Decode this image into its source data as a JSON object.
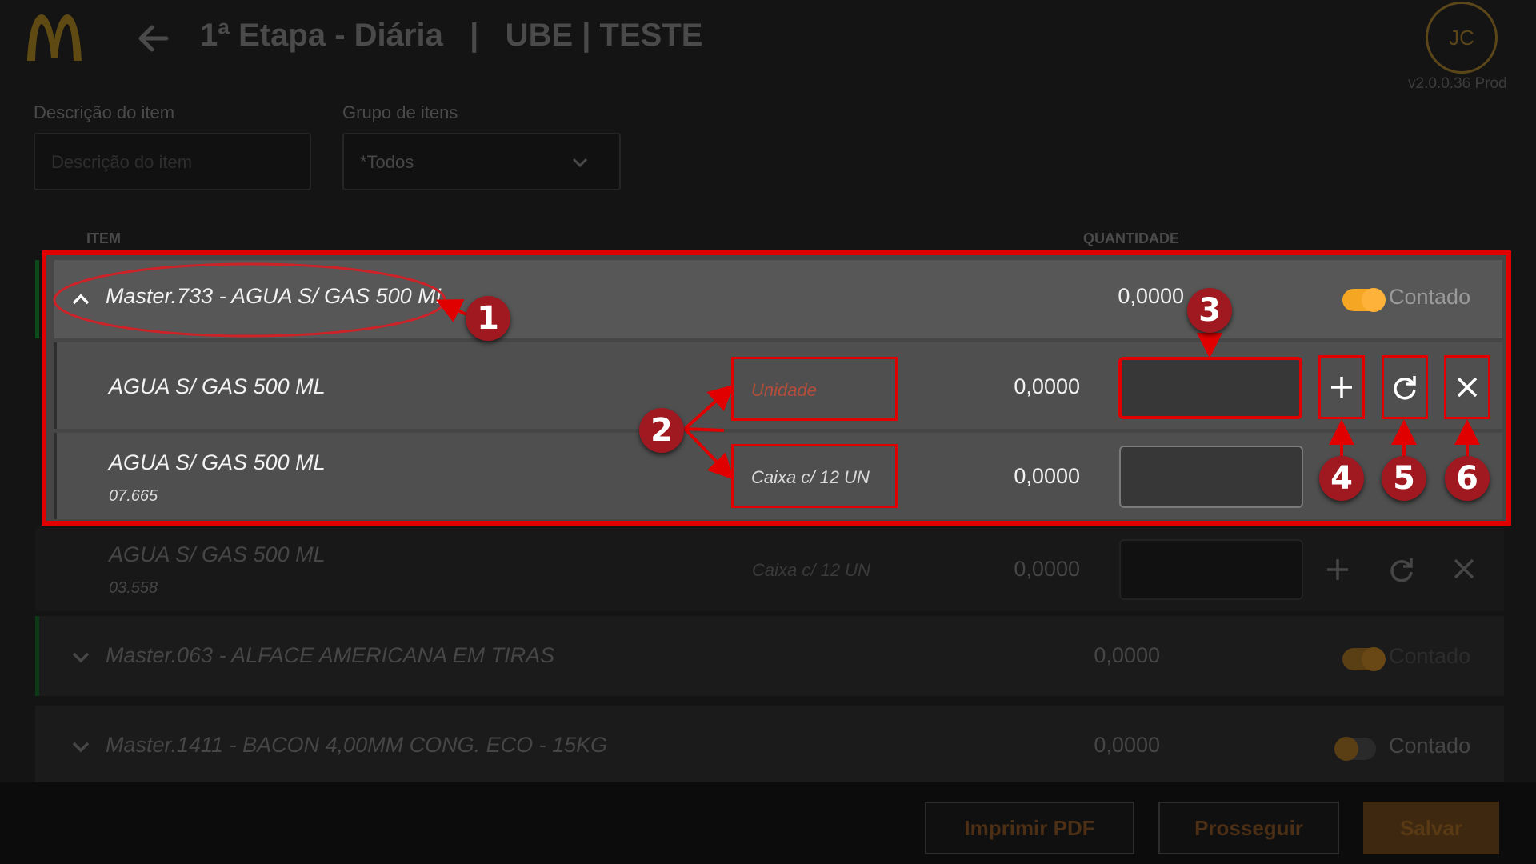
{
  "header": {
    "title": "1ª Etapa - Diária   |   UBE | TESTE",
    "avatar_initials": "JC",
    "version": "v2.0.0.36 Prod",
    "logo_icon": "mcdonalds-logo",
    "back_icon": "arrow-left-icon"
  },
  "filters": {
    "description_label": "Descrição do item",
    "description_placeholder": "Descrição do item",
    "group_label": "Grupo de itens",
    "group_value": "*Todos"
  },
  "columns": {
    "item": "ITEM",
    "quantity": "QUANTIDADE"
  },
  "master_expanded": {
    "name": "Master.733 - AGUA S/ GAS 500 ML",
    "quantity": "0,0000",
    "status_label": "Contado",
    "counted": true,
    "sub_items": [
      {
        "name": "AGUA S/ GAS 500 ML",
        "code": "",
        "unit": "Unidade",
        "quantity": "0,0000"
      },
      {
        "name": "AGUA S/ GAS 500 ML",
        "code": "07.665",
        "unit": "Caixa c/ 12 UN",
        "quantity": "0,0000"
      },
      {
        "name": "AGUA S/ GAS 500 ML",
        "code": "03.558",
        "unit": "Caixa c/ 12 UN",
        "quantity": "0,0000"
      }
    ]
  },
  "masters_collapsed": [
    {
      "name": "Master.063 - ALFACE AMERICANA EM TIRAS",
      "quantity": "0,0000",
      "status_label": "Contado",
      "counted": true
    },
    {
      "name": "Master.1411 - BACON 4,00MM CONG. ECO - 15KG",
      "quantity": "0,0000",
      "status_label": "Contado",
      "counted": false
    }
  ],
  "footer": {
    "print_label": "Imprimir PDF",
    "proceed_label": "Prosseguir",
    "save_label": "Salvar"
  },
  "annotations": [
    "1",
    "2",
    "3",
    "4",
    "5",
    "6"
  ],
  "colors": {
    "accent": "#f5a623",
    "annotation_red": "#e10000",
    "badge_red": "#a01820"
  }
}
